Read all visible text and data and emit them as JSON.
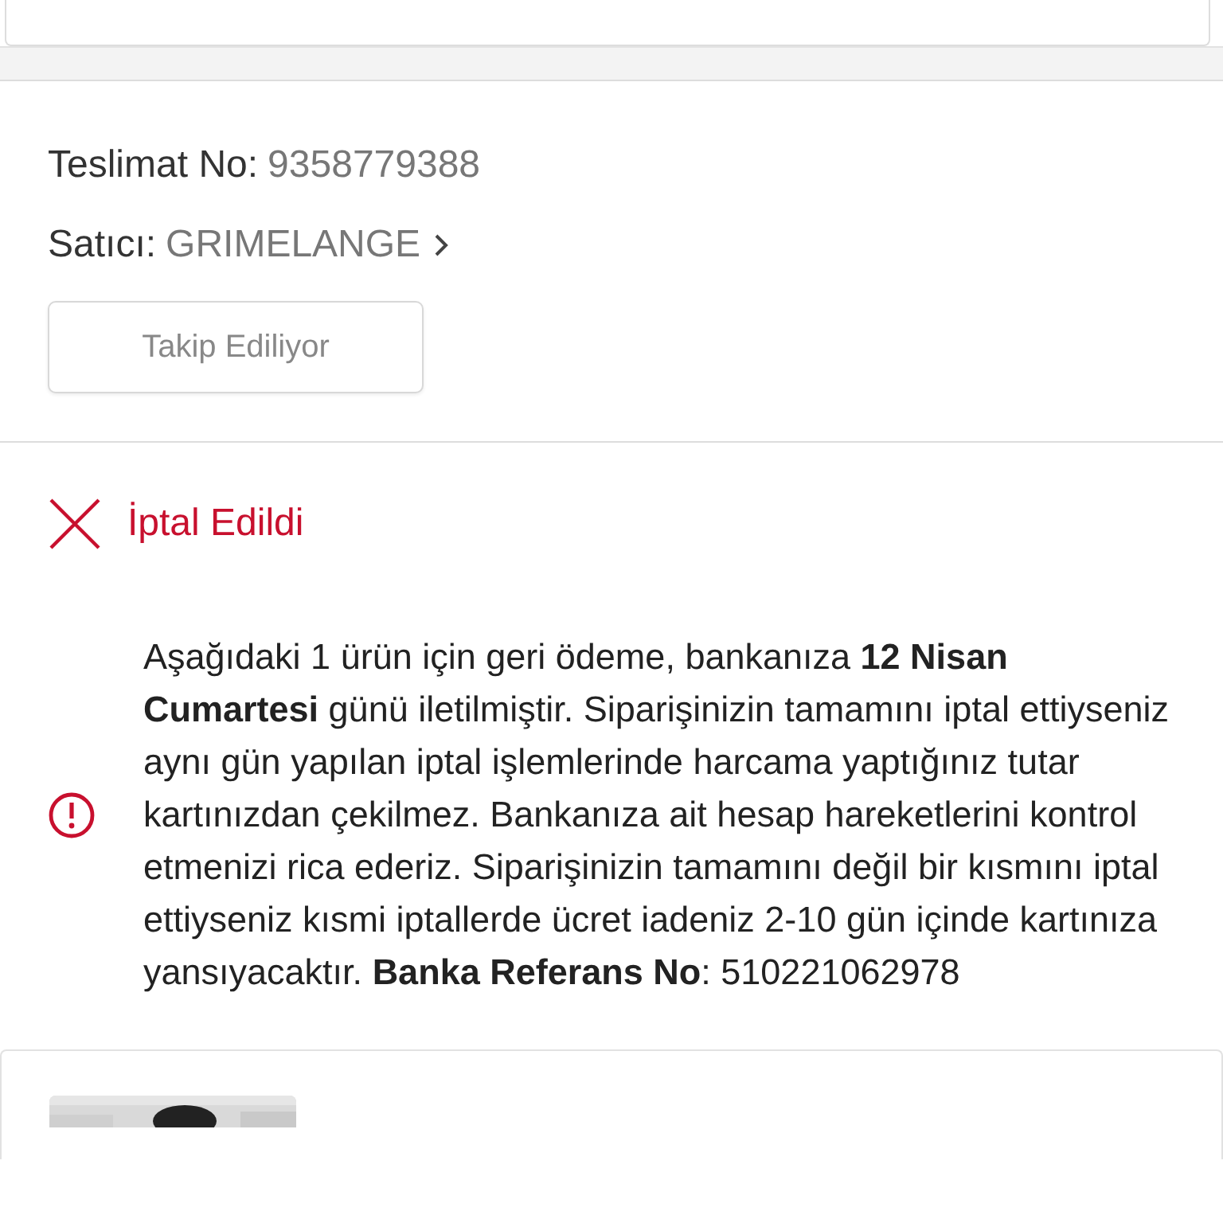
{
  "delivery": {
    "number_label": "Teslimat No:",
    "number": "9358779388",
    "seller_label": "Satıcı:",
    "seller": "GRIMELANGE",
    "follow_button": {
      "label": "Takip Ediliyor",
      "disabled": true
    }
  },
  "status": {
    "kind": "cancelled",
    "label": "İptal Edildi"
  },
  "refund_notice": {
    "text": "Aşağıdaki 1 ürün için geri ödeme, bankanıza **12 Nisan Cumartesi** günü iletilmiştir. Siparişinizin tamamını iptal ettiyseniz aynı gün yapılan iptal işlemlerinde harcama yaptığınız tutar kartınızdan çekilmez. Bankanıza ait hesap hareketlerini kontrol etmenizi rica ederiz. Siparişinizin tamamını değil bir kısmını iptal ettiyseniz kısmi iptallerde ücret iadeniz 2-10 gün içinde kartınıza yansıyacaktır. **Banka Referans No**: 510221062978"
  }
}
